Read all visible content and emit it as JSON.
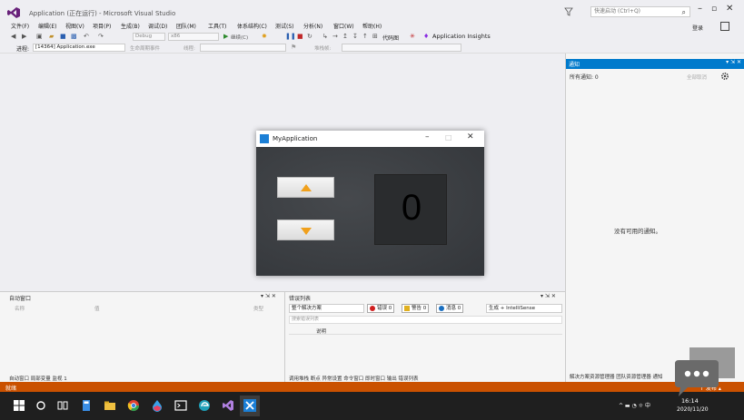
{
  "window": {
    "title": "Application (正在运行) - Microsoft Visual Studio",
    "quick_launch_placeholder": "快速启动 (Ctrl+Q)",
    "sign_in": "登录"
  },
  "menu": [
    "文件(F)",
    "编辑(E)",
    "视图(V)",
    "项目(P)",
    "生成(B)",
    "调试(D)",
    "团队(M)",
    "工具(T)",
    "体系结构(C)",
    "测试(S)",
    "分析(N)",
    "窗口(W)",
    "帮助(H)"
  ],
  "toolbar": {
    "config": "Debug",
    "platform": "x86",
    "continue": "继续(C)",
    "code_map": "代码图",
    "app_insights": "Application Insights"
  },
  "processbar": {
    "process_label": "进程:",
    "process_value": "[14364] Application.exe",
    "lifecycle": "生命周期事件",
    "thread": "线程:",
    "stack_frame": "堆栈帧:"
  },
  "myapp": {
    "title": "MyApplication",
    "counter": "0"
  },
  "notifications": {
    "title": "通知",
    "all": "所有通知: 0",
    "clear_all": "全部取消",
    "empty": "没有可用的通知。"
  },
  "autos": {
    "title": "自动窗口",
    "columns": [
      "名称",
      "值",
      "类型"
    ],
    "tabs": "自动窗口  局部变量  监视 1"
  },
  "errors": {
    "title": "错误列表",
    "scope": "整个解决方案",
    "errors_btn": "错误 0",
    "warnings_btn": "警告 0",
    "messages_btn": "消息 0",
    "build": "生成 + IntelliSense",
    "search_placeholder": "搜索错误列表",
    "col_desc": "说明",
    "tabs": "调用堆栈  断点  异常设置  命令窗口  即时窗口  输出  错误列表"
  },
  "solution_tabs": "解决方案资源管理器  团队资源管理器  通知",
  "status": {
    "text": "就绪",
    "publish": "↑ 发布 ▴"
  },
  "clock": {
    "time": "16:14",
    "date": "2020/11/20"
  },
  "colors": {
    "vs_accent": "#007acc",
    "status_orange": "#ca5100",
    "arrow_orange": "#f0a01c"
  }
}
